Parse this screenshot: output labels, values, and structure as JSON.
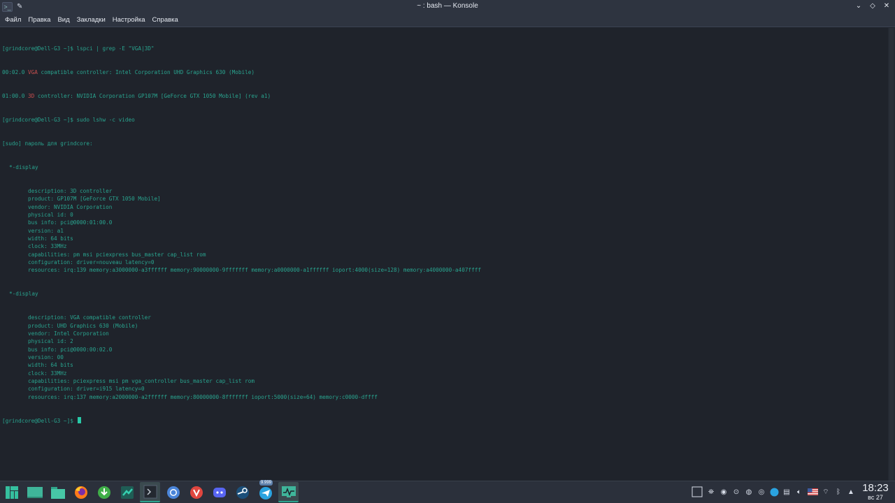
{
  "window": {
    "title": "~ : bash — Konsole"
  },
  "menu": [
    "Файл",
    "Правка",
    "Вид",
    "Закладки",
    "Настройка",
    "Справка"
  ],
  "terminal": {
    "l1": "[grindcore@Dell-G3 ~]$ lspci | grep -E \"VGA|3D\"",
    "l2a": "00:02.0 ",
    "l2b": "VGA",
    "l2c": " compatible controller: Intel Corporation UHD Graphics 630 (Mobile)",
    "l3a": "01:00.0 ",
    "l3b": "3D",
    "l3c": " controller: NVIDIA Corporation GP107M [GeForce GTX 1050 Mobile] (rev a1)",
    "l4": "[grindcore@Dell-G3 ~]$ sudo lshw -c video",
    "l5": "[sudo] пароль для grindcore:",
    "d1": "*-display",
    "d1_lines": [
      "description: 3D controller",
      "product: GP107M [GeForce GTX 1050 Mobile]",
      "vendor: NVIDIA Corporation",
      "physical id: 0",
      "bus info: pci@0000:01:00.0",
      "version: a1",
      "width: 64 bits",
      "clock: 33MHz",
      "capabilities: pm msi pciexpress bus_master cap_list rom",
      "configuration: driver=nouveau latency=0",
      "resources: irq:139 memory:a3000000-a3ffffff memory:90000000-9fffffff memory:a0000000-a1ffffff ioport:4000(size=128) memory:a4000000-a407ffff"
    ],
    "d2": "*-display",
    "d2_lines": [
      "description: VGA compatible controller",
      "product: UHD Graphics 630 (Mobile)",
      "vendor: Intel Corporation",
      "physical id: 2",
      "bus info: pci@0000:00:02.0",
      "version: 00",
      "width: 64 bits",
      "clock: 33MHz",
      "capabilities: pciexpress msi pm vga_controller bus_master cap_list rom",
      "configuration: driver=i915 latency=0",
      "resources: irq:137 memory:a2000000-a2ffffff memory:80000000-8fffffff ioport:5000(size=64) memory:c0000-dffff"
    ],
    "prompt": "[grindcore@Dell-G3 ~]$ "
  },
  "taskbar": {
    "steam_badge": "9.999",
    "clock_time": "18:23",
    "clock_date": "вс 27"
  },
  "colors": {
    "accent": "#29a38e",
    "terminal_bg": "#1f232b",
    "highlight_red": "#c94f4f"
  }
}
